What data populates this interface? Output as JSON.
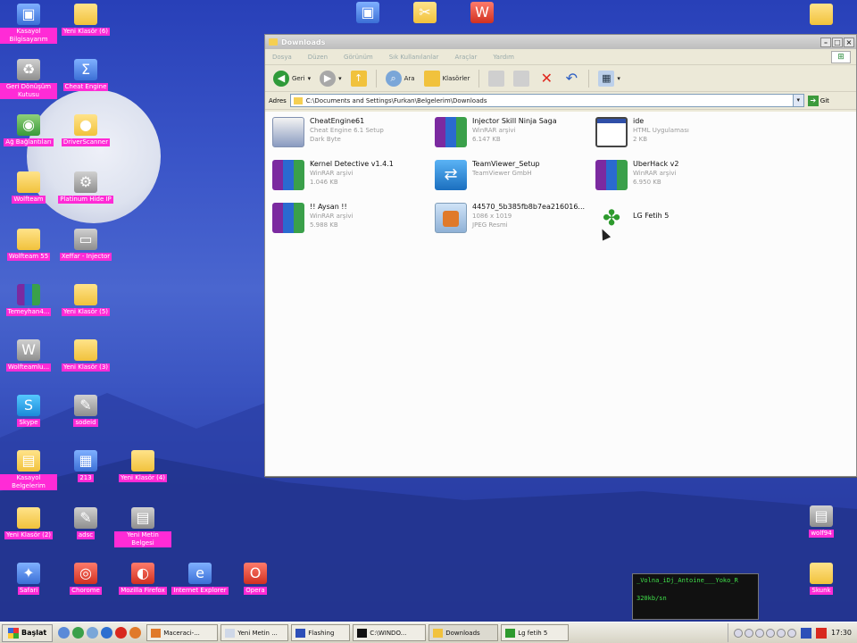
{
  "desktop": {
    "icons": [
      {
        "label": "Kasayol Bilgisayarım",
        "icon": "computer-icon"
      },
      {
        "label": "Yeni Klasör (6)",
        "icon": "folder-icon"
      },
      {
        "label": "Geri Dönüşüm Kutusu",
        "icon": "recycle-bin-icon"
      },
      {
        "label": "Cheat Engine",
        "icon": "cheat-engine-icon"
      },
      {
        "label": "Ağ Bağlantıları",
        "icon": "network-icon"
      },
      {
        "label": "DriverScanner",
        "icon": "driver-scanner-icon"
      },
      {
        "label": "Wolfteam",
        "icon": "folder-icon"
      },
      {
        "label": "Platinum Hide IP",
        "icon": "platinum-hide-ip-icon"
      },
      {
        "label": "Wolfteam 55",
        "icon": "folder-icon"
      },
      {
        "label": "Xeffar - Injector",
        "icon": "injector-icon"
      },
      {
        "label": "Temeyhan4...",
        "icon": "winrar-icon"
      },
      {
        "label": "Yeni Klasör (5)",
        "icon": "folder-icon"
      },
      {
        "label": "Wolfteamlu...",
        "icon": "wolfteam-icon"
      },
      {
        "label": "Yeni Klasör (3)",
        "icon": "folder-icon"
      },
      {
        "label": "Skype",
        "icon": "skype-icon"
      },
      {
        "label": "sodeid",
        "icon": "notepad-icon"
      },
      {
        "label": "Kasayol Belgelerim",
        "icon": "documents-icon"
      },
      {
        "label": "213",
        "icon": "image-icon"
      },
      {
        "label": "Yeni Klasör (4)",
        "icon": "folder-icon"
      },
      {
        "label": "Yeni Klasör (2)",
        "icon": "folder-icon"
      },
      {
        "label": "adsc",
        "icon": "notepad-icon"
      },
      {
        "label": "Yeni Metin Belgesi",
        "icon": "text-document-icon"
      },
      {
        "label": "Safari",
        "icon": "safari-icon"
      },
      {
        "label": "Chorome",
        "icon": "chrome-icon"
      },
      {
        "label": "Mozilla Firefox",
        "icon": "firefox-icon"
      },
      {
        "label": "Internet Explorer",
        "icon": "ie-icon"
      },
      {
        "label": "Opera",
        "icon": "opera-icon"
      },
      {
        "label": "wolf94",
        "icon": "text-document-icon"
      },
      {
        "label": "Skunk",
        "icon": "folder-icon"
      }
    ]
  },
  "explorer": {
    "title": "Downloads",
    "menu": [
      "Dosya",
      "Düzen",
      "Görünüm",
      "Sık Kullanılanlar",
      "Araçlar",
      "Yardım"
    ],
    "toolbar": {
      "back": "Geri",
      "search": "Ara",
      "folders": "Klasörler"
    },
    "address": {
      "label": "Adres",
      "path": "C:\\Documents and Settings\\Furkan\\Belgelerim\\Downloads",
      "go": "Git"
    },
    "files": [
      {
        "name": "CheatEngine61",
        "line2": "Cheat Engine 6.1 Setup",
        "line3": "Dark Byte",
        "icon": "cheat-engine-setup-icon"
      },
      {
        "name": "Injector Skill Ninja Saga",
        "line2": "WinRAR arşivi",
        "line3": "6.147 KB",
        "icon": "winrar-icon"
      },
      {
        "name": "ide",
        "line2": "HTML Uygulaması",
        "line3": "2 KB",
        "icon": "html-app-icon"
      },
      {
        "name": "Kernel Detective v1.4.1",
        "line2": "WinRAR arşivi",
        "line3": "1.046 KB",
        "icon": "winrar-icon"
      },
      {
        "name": "TeamViewer_Setup",
        "line2": "TeamViewer GmbH",
        "line3": "",
        "icon": "teamviewer-icon"
      },
      {
        "name": "UberHack v2",
        "line2": "WinRAR arşivi",
        "line3": "6.950 KB",
        "icon": "winrar-icon"
      },
      {
        "name": "!! Aysan !!",
        "line2": "WinRAR arşivi",
        "line3": "5.988 KB",
        "icon": "winrar-icon"
      },
      {
        "name": "44570_5b385fb8b7ea216016...",
        "line2": "1086 x 1019",
        "line3": "JPEG Resmi",
        "icon": "jpeg-icon"
      },
      {
        "name": "LG Fetih 5",
        "line2": "",
        "line3": "",
        "icon": "lg-fetih-icon"
      }
    ]
  },
  "player": {
    "title": "_Volna_iDj_Antoine___Yoko_R",
    "rate": "320kb/sn"
  },
  "taskbar": {
    "start": "Başlat",
    "tasks": [
      "Maceraci-...",
      "Yeni Metin ...",
      "Flashing",
      "C:\\WINDO...",
      "Downloads",
      "Lg fetih 5"
    ],
    "clock": "17:30"
  }
}
